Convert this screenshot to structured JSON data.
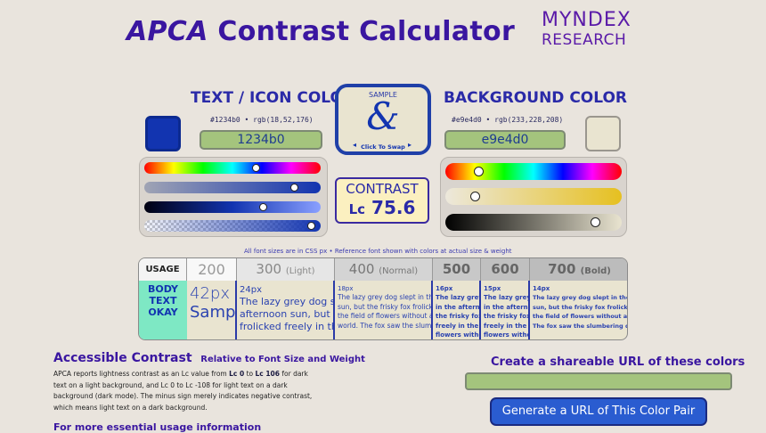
{
  "header": {
    "title_apca": "APCA",
    "title_rest": "Contrast Calculator",
    "logo_line1": "MYNDEX",
    "logo_line2": "RESEARCH"
  },
  "text_color": {
    "heading": "TEXT / ICON COLOR",
    "readout": "#1234b0 • rgb(18,52,176)",
    "hex_value": "1234b0",
    "swatch_color": "#1234b0"
  },
  "background_color": {
    "heading": "BACKGROUND COLOR",
    "readout": "#e9e4d0 • rgb(233,228,208)",
    "hex_value": "e9e4d0",
    "swatch_color": "#e9e4d0"
  },
  "swap": {
    "sample_label": "SAMPLE",
    "glyph": "&",
    "click_label": "Click To Swap"
  },
  "contrast": {
    "label": "CONTRAST",
    "lc_prefix": "Lc",
    "value": "75.6"
  },
  "font_note": "All font sizes are in CSS px • Reference font shown with colors at actual size & weight",
  "table": {
    "usage_label": "USAGE",
    "usage_verdict": "BODY TEXT OKAY",
    "weights": [
      {
        "weight": "200",
        "name": ""
      },
      {
        "weight": "300",
        "name": "(Light)"
      },
      {
        "weight": "400",
        "name": "(Normal)"
      },
      {
        "weight": "500",
        "name": ""
      },
      {
        "weight": "600",
        "name": ""
      },
      {
        "weight": "700",
        "name": "(Bold)"
      }
    ],
    "cells": [
      {
        "size": "42px",
        "text": "Sample"
      },
      {
        "size": "24px",
        "text": "The lazy grey dog slept in the afternoon sun, but the frisky fox frolicked freely in the field"
      },
      {
        "size": "18px",
        "text": "The lazy grey dog slept in the afternoon sun, but the frisky fox frolicked freely in the field of flowers without a care in the world. The fox saw the slumbering dog"
      },
      {
        "size": "16px",
        "text": "The lazy grey dog slept in the afternoon sun, but the frisky fox frolicked freely in the field of flowers without a care. The fox saw the"
      },
      {
        "size": "15px",
        "text": "The lazy grey dog slept in the afternoon sun, but the frisky fox frolicked freely in the field of flowers without a care. The fox saw the"
      },
      {
        "size": "14px",
        "text": "The lazy grey dog slept in the afternoon sun, but the frisky fox frolicked freely in the field of flowers without a care in the The fox saw the slumbering dog"
      }
    ]
  },
  "accessible": {
    "heading": "Accessible Contrast",
    "subheading": "Relative to Font Size and Weight",
    "p_1": "APCA reports lightness contrast as an Lc value from ",
    "p_lc0": "Lc 0",
    "p_to": " to ",
    "p_lc106": "Lc 106",
    "p_2": " for dark text on a light background, and Lc 0 to Lc -108 for light text on a dark background (dark mode). The minus sign merely indicates negative contrast, which means light text on a dark background.",
    "more_heading": "For more essential usage information"
  },
  "share": {
    "heading": "Create a shareable URL of these colors",
    "url_value": "",
    "button_label": "Generate a URL of This Color Pair"
  },
  "slider_values": {
    "text_hue": 0.64,
    "text_chroma": 0.87,
    "text_lightness": 0.68,
    "text_alpha": 0.97,
    "bg_hue": 0.17,
    "bg_chroma": 0.15,
    "bg_lightness": 0.87
  }
}
